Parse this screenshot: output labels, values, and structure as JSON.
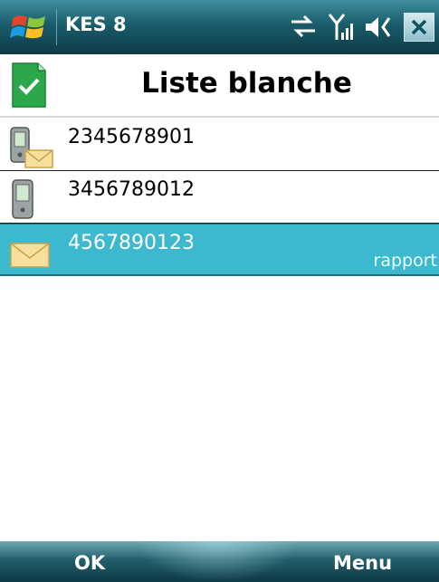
{
  "statusbar": {
    "app_title": "KES 8",
    "icons": [
      "windows-start-icon",
      "sync-icon",
      "signal-icon",
      "volume-icon",
      "close-icon"
    ]
  },
  "titlebar": {
    "title": "Liste blanche",
    "icon": "checkmark-document-icon",
    "accent": "#2aa84a"
  },
  "list": {
    "items": [
      {
        "number": "2345678901",
        "icon": "phone-and-sms-icon",
        "sub": ""
      },
      {
        "number": "3456789012",
        "icon": "phone-icon",
        "sub": ""
      },
      {
        "number": "4567890123",
        "icon": "sms-envelope-icon",
        "sub": "rapport",
        "selected": true
      }
    ],
    "selected_color": "#3db9cf"
  },
  "softkeys": {
    "left": "OK",
    "right": "Menu"
  }
}
